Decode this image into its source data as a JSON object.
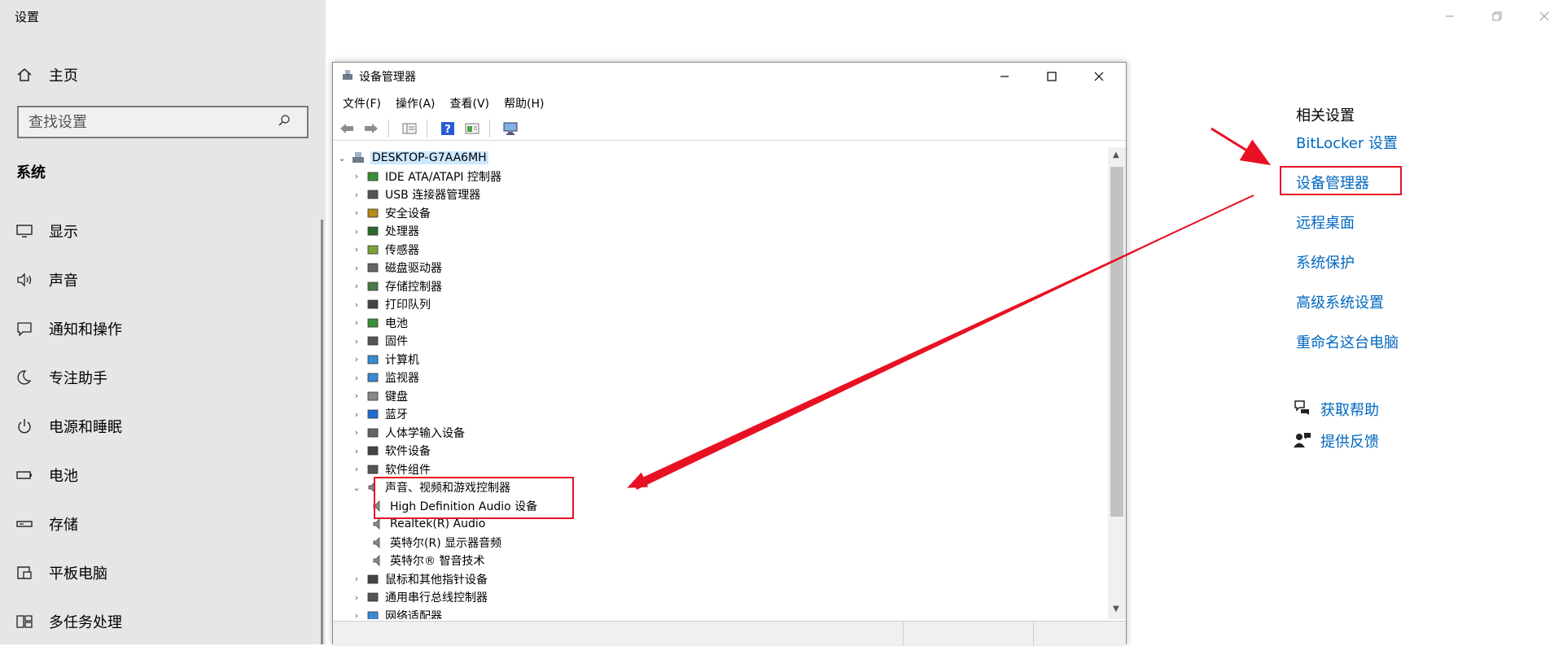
{
  "settings": {
    "title": "设置",
    "home_label": "主页",
    "search_placeholder": "查找设置",
    "section_title": "系统",
    "nav": [
      {
        "label": "显示",
        "icon": "monitor-icon"
      },
      {
        "label": "声音",
        "icon": "speaker-icon"
      },
      {
        "label": "通知和操作",
        "icon": "notification-icon"
      },
      {
        "label": "专注助手",
        "icon": "moon-icon"
      },
      {
        "label": "电源和睡眠",
        "icon": "power-icon"
      },
      {
        "label": "电池",
        "icon": "battery-icon"
      },
      {
        "label": "存储",
        "icon": "storage-icon"
      },
      {
        "label": "平板电脑",
        "icon": "tablet-icon"
      },
      {
        "label": "多任务处理",
        "icon": "multitask-icon"
      }
    ]
  },
  "related": {
    "title": "相关设置",
    "links": [
      "BitLocker 设置",
      "设备管理器",
      "远程桌面",
      "系统保护",
      "高级系统设置",
      "重命名这台电脑"
    ],
    "help": [
      {
        "label": "获取帮助",
        "icon": "help-chat-icon"
      },
      {
        "label": "提供反馈",
        "icon": "feedback-icon"
      }
    ]
  },
  "device_manager": {
    "title": "设备管理器",
    "menu": [
      "文件(F)",
      "操作(A)",
      "查看(V)",
      "帮助(H)"
    ],
    "root": "DESKTOP-G7AA6MH",
    "categories": [
      "IDE ATA/ATAPI 控制器",
      "USB 连接器管理器",
      "安全设备",
      "处理器",
      "传感器",
      "磁盘驱动器",
      "存储控制器",
      "打印队列",
      "电池",
      "固件",
      "计算机",
      "监视器",
      "键盘",
      "蓝牙",
      "人体学输入设备",
      "软件设备",
      "软件组件",
      "声音、视频和游戏控制器"
    ],
    "audio_children": [
      "High Definition Audio 设备",
      "Realtek(R) Audio",
      "英特尔(R) 显示器音频",
      "英特尔® 智音技术"
    ],
    "after_categories": [
      "鼠标和其他指针设备",
      "通用串行总线控制器",
      "网络适配器"
    ]
  },
  "colors": {
    "accent_link": "#0067c0",
    "annotation": "#e81123",
    "left_pane_bg": "#e6e6e6"
  }
}
